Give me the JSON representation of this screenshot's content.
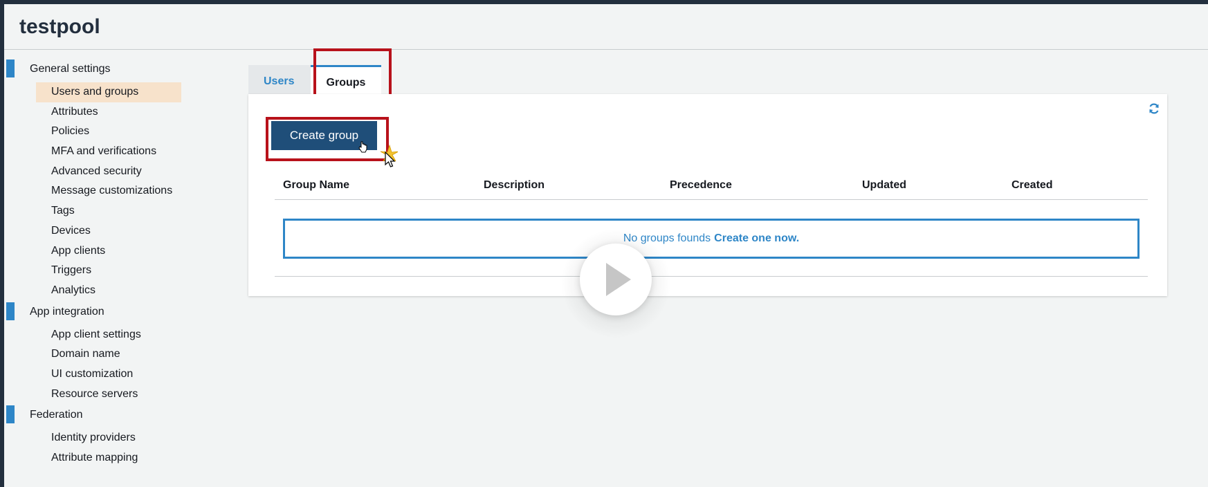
{
  "header": {
    "pool_name": "testpool"
  },
  "sidebar": {
    "sections": [
      {
        "label": "General settings",
        "items": [
          {
            "label": "Users and groups",
            "active": true
          },
          {
            "label": "Attributes"
          },
          {
            "label": "Policies"
          },
          {
            "label": "MFA and verifications"
          },
          {
            "label": "Advanced security"
          },
          {
            "label": "Message customizations"
          },
          {
            "label": "Tags"
          },
          {
            "label": "Devices"
          },
          {
            "label": "App clients"
          },
          {
            "label": "Triggers"
          },
          {
            "label": "Analytics"
          }
        ]
      },
      {
        "label": "App integration",
        "items": [
          {
            "label": "App client settings"
          },
          {
            "label": "Domain name"
          },
          {
            "label": "UI customization"
          },
          {
            "label": "Resource servers"
          }
        ]
      },
      {
        "label": "Federation",
        "items": [
          {
            "label": "Identity providers"
          },
          {
            "label": "Attribute mapping"
          }
        ]
      }
    ]
  },
  "tabs": {
    "users_label": "Users",
    "groups_label": "Groups",
    "active": "Groups"
  },
  "groups": {
    "create_button_label": "Create group",
    "columns": [
      "Group Name",
      "Description",
      "Precedence",
      "Updated",
      "Created"
    ],
    "empty_text": "No groups founds",
    "empty_link": "Create one now."
  },
  "colors": {
    "accent": "#2e86c7",
    "primary_button": "#1f4e79",
    "highlight_border": "#b8121b",
    "active_nav": "#f7e2cb"
  },
  "icons": {
    "refresh": "refresh-icon",
    "play": "play-icon",
    "cursor": "hand-cursor-icon"
  }
}
